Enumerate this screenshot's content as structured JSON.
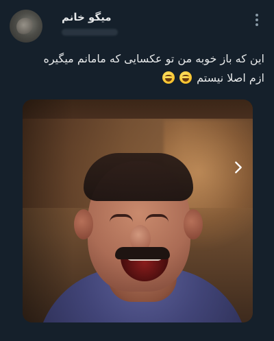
{
  "tweet": {
    "author": {
      "display_name": "میگو خانم"
    },
    "text_lines": [
      "این که باز خوبه من تو عکسایی که مامانم میگیره",
      "ازم اصلا نیستم"
    ],
    "media": {
      "has_next": true
    }
  },
  "icons": {
    "more": "more-vertical-icon",
    "next": "chevron-right-icon"
  }
}
